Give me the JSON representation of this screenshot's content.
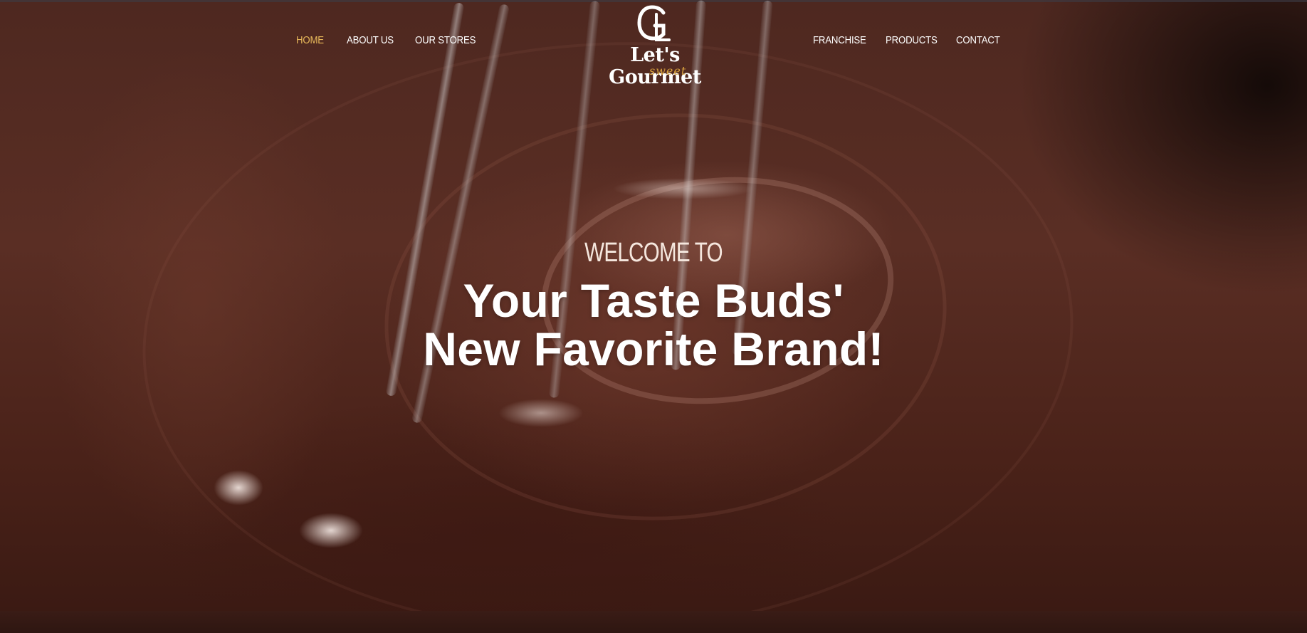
{
  "nav": {
    "left": [
      {
        "label": "HOME",
        "active": true
      },
      {
        "label": "ABOUT US",
        "active": false
      },
      {
        "label": "OUR STORES",
        "active": false
      }
    ],
    "right": [
      {
        "label": "FRANCHISE",
        "active": false
      },
      {
        "label": "PRODUCTS",
        "active": false
      },
      {
        "label": "CONTACT",
        "active": false
      }
    ]
  },
  "logo": {
    "name": "Let's Gourmet",
    "sub": "sweet",
    "mark": "GL"
  },
  "hero": {
    "welcome": "WELCOME TO",
    "headline_line1": "Your Taste Buds'",
    "headline_line2": "New Favorite Brand!"
  },
  "colors": {
    "accent": "#e7b85a",
    "logo_sub": "#d8a23e",
    "text": "#ffffff",
    "chocolate": "#4e2820"
  }
}
